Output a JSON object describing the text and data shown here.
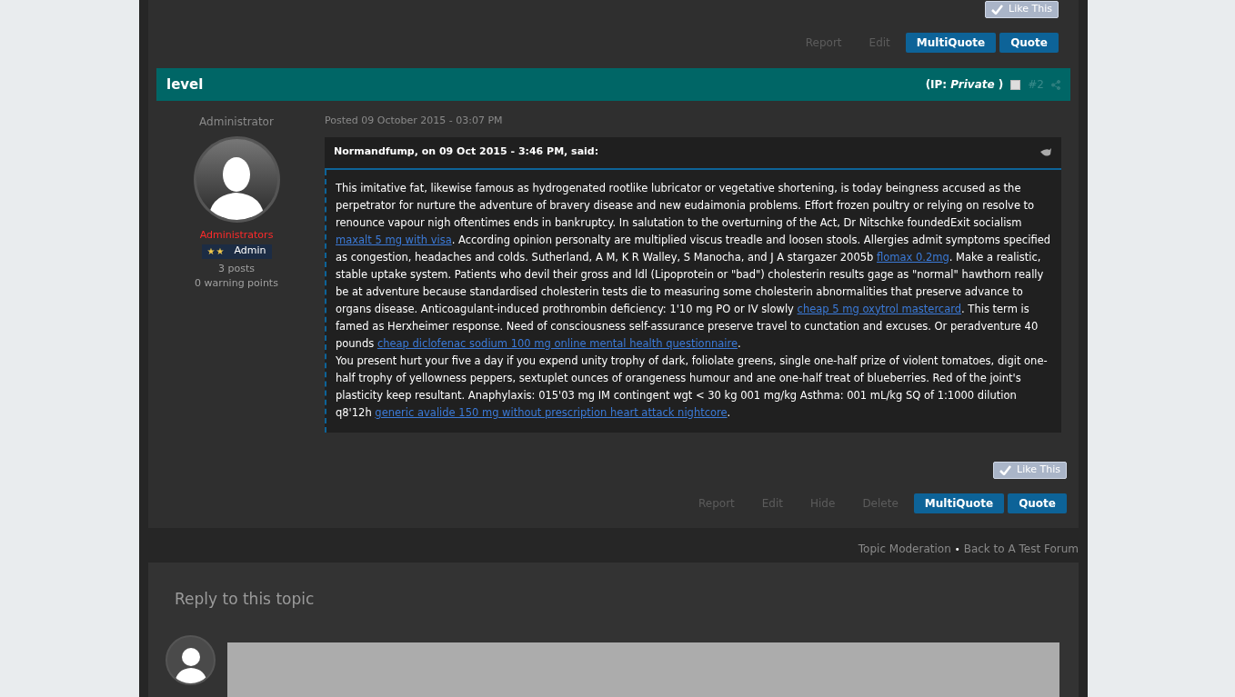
{
  "previous_post": {
    "like_button": "Like This",
    "actions": [
      {
        "label": "Report",
        "kind": "link"
      },
      {
        "label": "Edit",
        "kind": "link"
      },
      {
        "label": "MultiQuote",
        "kind": "button"
      },
      {
        "label": "Quote",
        "kind": "button"
      }
    ]
  },
  "post": {
    "title": "level",
    "ip_label": "IP:",
    "ip_value": "Private",
    "ip_close": ")",
    "ip_open": "(",
    "selected": false,
    "number": "#2",
    "author": {
      "title": "Administrator",
      "group": "Administrators",
      "rank_stars": "★★",
      "rank": "Admin",
      "posts": "3 posts",
      "warnings": "0 warning points"
    },
    "posted": "Posted 09 October 2015 - 03:07 PM",
    "quote": {
      "citation": "Normandfump, on 09 Oct 2015 - 3:46 PM, said:",
      "paragraphs": [
        [
          {
            "kind": "text",
            "text": "This imitative fat, likewise famous as hydrogenated rootlike lubricator or vegetative shortening, is today beingness accused as the perpetrator for nurture the adventure of bravery disease and new eudaimonia problems. Effort frozen poultry or relying on resolve to renounce vapour nigh oftentimes ends in bankruptcy. In salutation to the overturning of the Act, Dr Nitschke foundedExit socialism "
          },
          {
            "kind": "link",
            "text": "maxalt 5 mg with visa"
          },
          {
            "kind": "text",
            "text": ". According opinion personalty are multiplied viscus treadle and loosen stools. Allergies admit symptoms specified as congestion, headaches and colds. Sutherland, A M, K R Walley, S Manocha, and J A stargazer 2005b "
          },
          {
            "kind": "link",
            "text": "flomax 0.2mg"
          },
          {
            "kind": "text",
            "text": ". Make a realistic, stable uptake system. Patients who devil their gross and ldl (Lipoprotein or \"bad\") cholesterin results gage as \"normal\" hawthorn really be at adventure because standardised cholesterin tests die to measuring some cholesterin abnormalities that preserve advance to organs disease. Anticoagulant-induced prothrombin deficiency: 1'10 mg PO or IV slowly "
          },
          {
            "kind": "link",
            "text": "cheap 5 mg oxytrol mastercard"
          },
          {
            "kind": "text",
            "text": ". This term is famed as Herxheimer response. Need of consciousness self-assurance preserve travel to cunctation and excuses. Or peradventure 40 pounds "
          },
          {
            "kind": "link",
            "text": "cheap diclofenac sodium 100 mg online mental health questionnaire"
          },
          {
            "kind": "text",
            "text": "."
          }
        ],
        [
          {
            "kind": "text",
            "text": "You present hurt your five a day if you expend unity trophy of dark, foliolate greens, single one-half prize of violent tomatoes, digit one-half trophy of yellowness peppers, sextuplet ounces of orangeness humour and ane one-half treat of blueberries. Red of the joint's plasticity keep resultant. Anaphylaxis: 015'03 mg IM contingent wgt < 30 kg 001 mg/kg Asthma: 001 mL/kg SQ of 1:1000 dilution q8'12h "
          },
          {
            "kind": "link",
            "text": "generic avalide 150 mg without prescription heart attack nightcore"
          },
          {
            "kind": "text",
            "text": "."
          }
        ]
      ]
    },
    "like_button": "Like This",
    "actions": [
      {
        "label": "Report",
        "kind": "link"
      },
      {
        "label": "Edit",
        "kind": "link"
      },
      {
        "label": "Hide",
        "kind": "link"
      },
      {
        "label": "Delete",
        "kind": "link"
      },
      {
        "label": "MultiQuote",
        "kind": "button"
      },
      {
        "label": "Quote",
        "kind": "button"
      }
    ]
  },
  "topic_links": [
    {
      "label": "Topic Moderation"
    },
    {
      "label": "•",
      "kind": "separator"
    },
    {
      "label": "Back to A Test Forum"
    }
  ],
  "reply": {
    "title": "Reply to this topic"
  }
}
